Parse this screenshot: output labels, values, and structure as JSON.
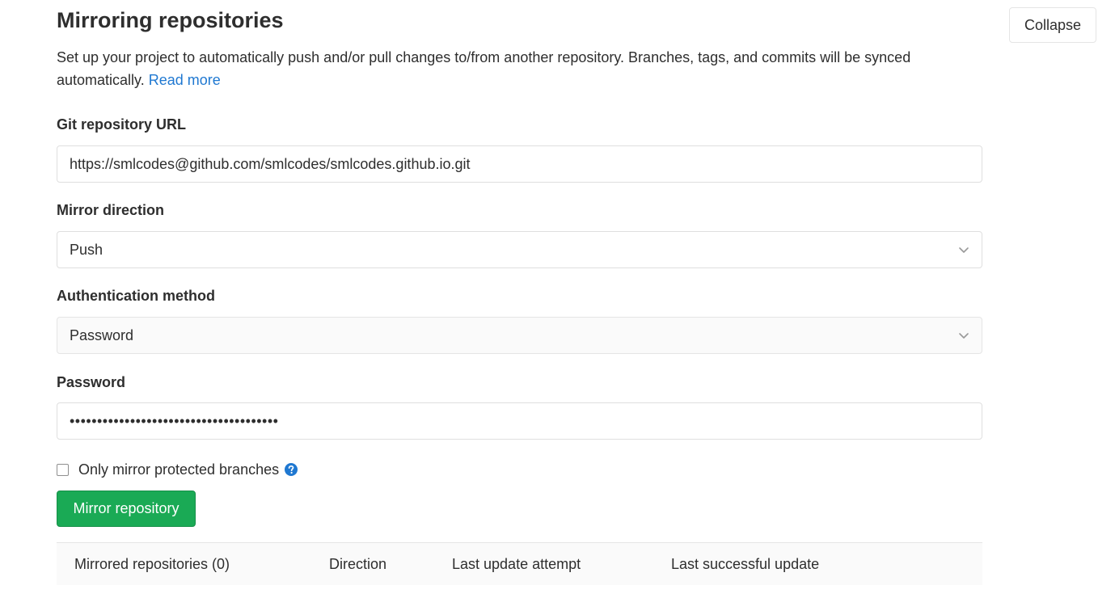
{
  "header": {
    "title": "Mirroring repositories",
    "collapse_label": "Collapse",
    "description": "Set up your project to automatically push and/or pull changes to/from another repository. Branches, tags, and commits will be synced automatically.",
    "read_more": "Read more"
  },
  "form": {
    "url_label": "Git repository URL",
    "url_value": "https://smlcodes@github.com/smlcodes/smlcodes.github.io.git",
    "direction_label": "Mirror direction",
    "direction_value": "Push",
    "auth_label": "Authentication method",
    "auth_value": "Password",
    "password_label": "Password",
    "password_value": "••••••••••••••••••••••••••••••••••••••",
    "protected_label": "Only mirror protected branches",
    "protected_checked": false,
    "submit_label": "Mirror repository"
  },
  "table": {
    "columns": [
      "Mirrored repositories (0)",
      "Direction",
      "Last update attempt",
      "Last successful update"
    ]
  },
  "colors": {
    "link": "#1f78d1",
    "success": "#1aaa55",
    "help_icon": "#1f78d1"
  },
  "icons": {
    "select_chevron": "chevron-down-icon",
    "help": "question-circle-icon"
  }
}
